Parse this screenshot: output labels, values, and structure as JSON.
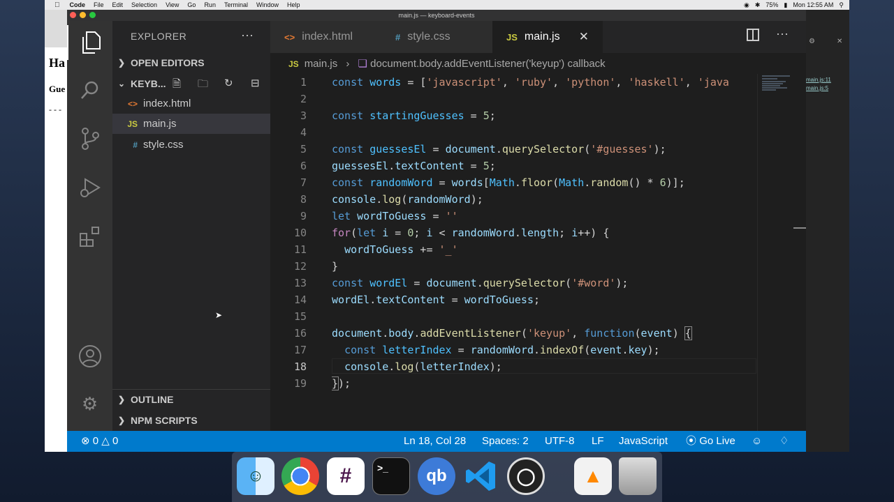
{
  "menubar": {
    "app": "Code",
    "items": [
      "File",
      "Edit",
      "Selection",
      "View",
      "Go",
      "Run",
      "Terminal",
      "Window",
      "Help"
    ],
    "battery": "75%",
    "clock": "Mon 12:55 AM"
  },
  "window": {
    "title": "main.js — keyboard-events"
  },
  "background_browser": {
    "heading": "Ha",
    "label": "Gue",
    "dashes": "- - -"
  },
  "devtools": {
    "links": [
      "main.js:11",
      "main.js:5"
    ]
  },
  "sidebar": {
    "title": "EXPLORER",
    "more": "···",
    "open_editors": "OPEN EDITORS",
    "folder": "KEYB...",
    "files": [
      {
        "icon": "<>",
        "name": "index.html"
      },
      {
        "icon": "JS",
        "name": "main.js"
      },
      {
        "icon": "#",
        "name": "style.css"
      }
    ],
    "outline": "OUTLINE",
    "npm_scripts": "NPM SCRIPTS"
  },
  "tabs": [
    {
      "icon": "<>",
      "label": "index.html"
    },
    {
      "icon": "#",
      "label": "style.css"
    },
    {
      "icon": "JS",
      "label": "main.js",
      "close": "✕"
    }
  ],
  "breadcrumb": {
    "icon": "JS",
    "file": "main.js",
    "symbol": "document.body.addEventListener('keyup') callback"
  },
  "editor": {
    "line_numbers": [
      "1",
      "2",
      "3",
      "4",
      "5",
      "6",
      "7",
      "8",
      "9",
      "10",
      "11",
      "12",
      "13",
      "14",
      "15",
      "16",
      "17",
      "18",
      "19"
    ],
    "current_line": 18
  },
  "status": {
    "errors": "0",
    "warnings": "0",
    "position": "Ln 18, Col 28",
    "spaces": "Spaces: 2",
    "encoding": "UTF-8",
    "eol": "LF",
    "language": "JavaScript",
    "golive": "Go Live"
  },
  "dock": [
    "Finder",
    "Chrome",
    "Slack",
    "Terminal",
    "qBittorrent",
    "VS Code",
    "OBS",
    "VLC",
    "Trash"
  ],
  "colors": {
    "accent": "#007acc",
    "sidebar": "#252526",
    "editor": "#1e1e1e"
  }
}
